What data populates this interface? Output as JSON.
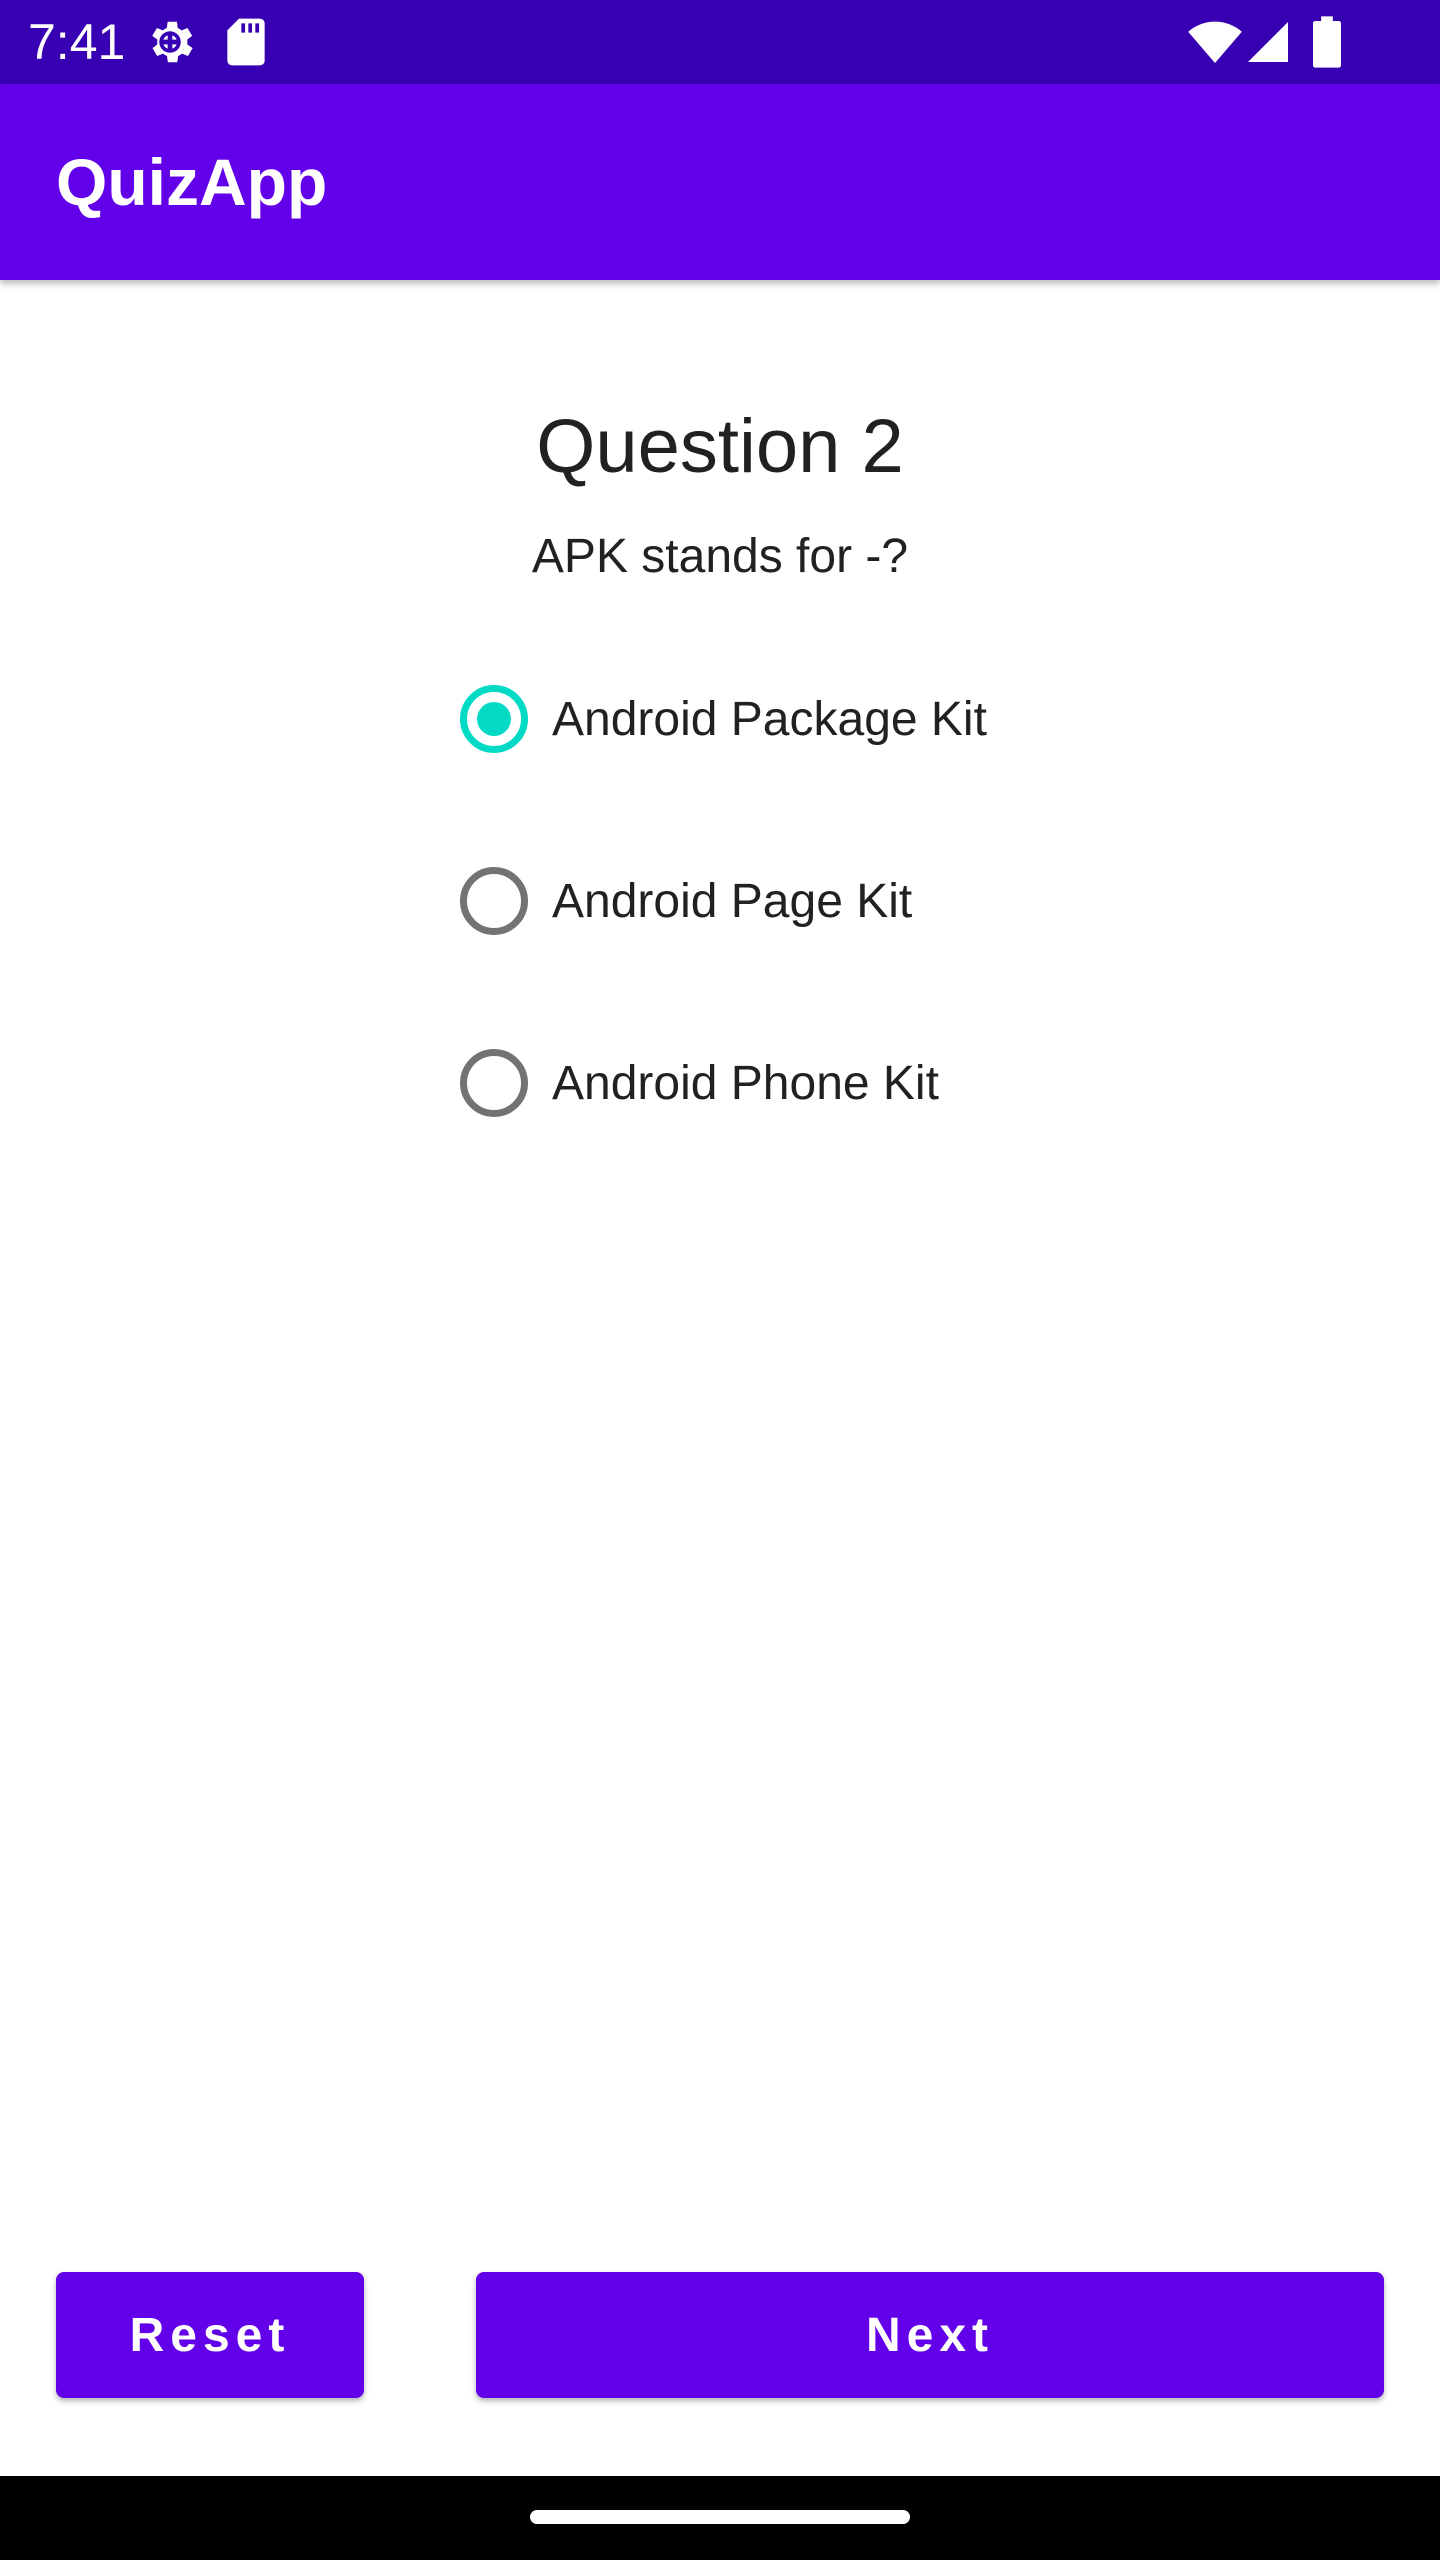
{
  "status_bar": {
    "time": "7:41",
    "icons": [
      "settings-gear-icon",
      "sd-card-icon",
      "wifi-icon",
      "cell-signal-icon",
      "battery-icon"
    ],
    "background": "#3700b3"
  },
  "app_bar": {
    "title": "QuizApp",
    "background": "#6200ea"
  },
  "question": {
    "title": "Question 2",
    "text": "APK stands for -?",
    "options": [
      {
        "label": "Android Package Kit",
        "checked": true
      },
      {
        "label": "Android Page Kit",
        "checked": false
      },
      {
        "label": "Android Phone Kit",
        "checked": false
      }
    ],
    "radio_checked_color": "#03dac5",
    "radio_unchecked_color": "#737373"
  },
  "buttons": {
    "reset_label": "Reset",
    "next_label": "Next",
    "background": "#6200ea"
  }
}
